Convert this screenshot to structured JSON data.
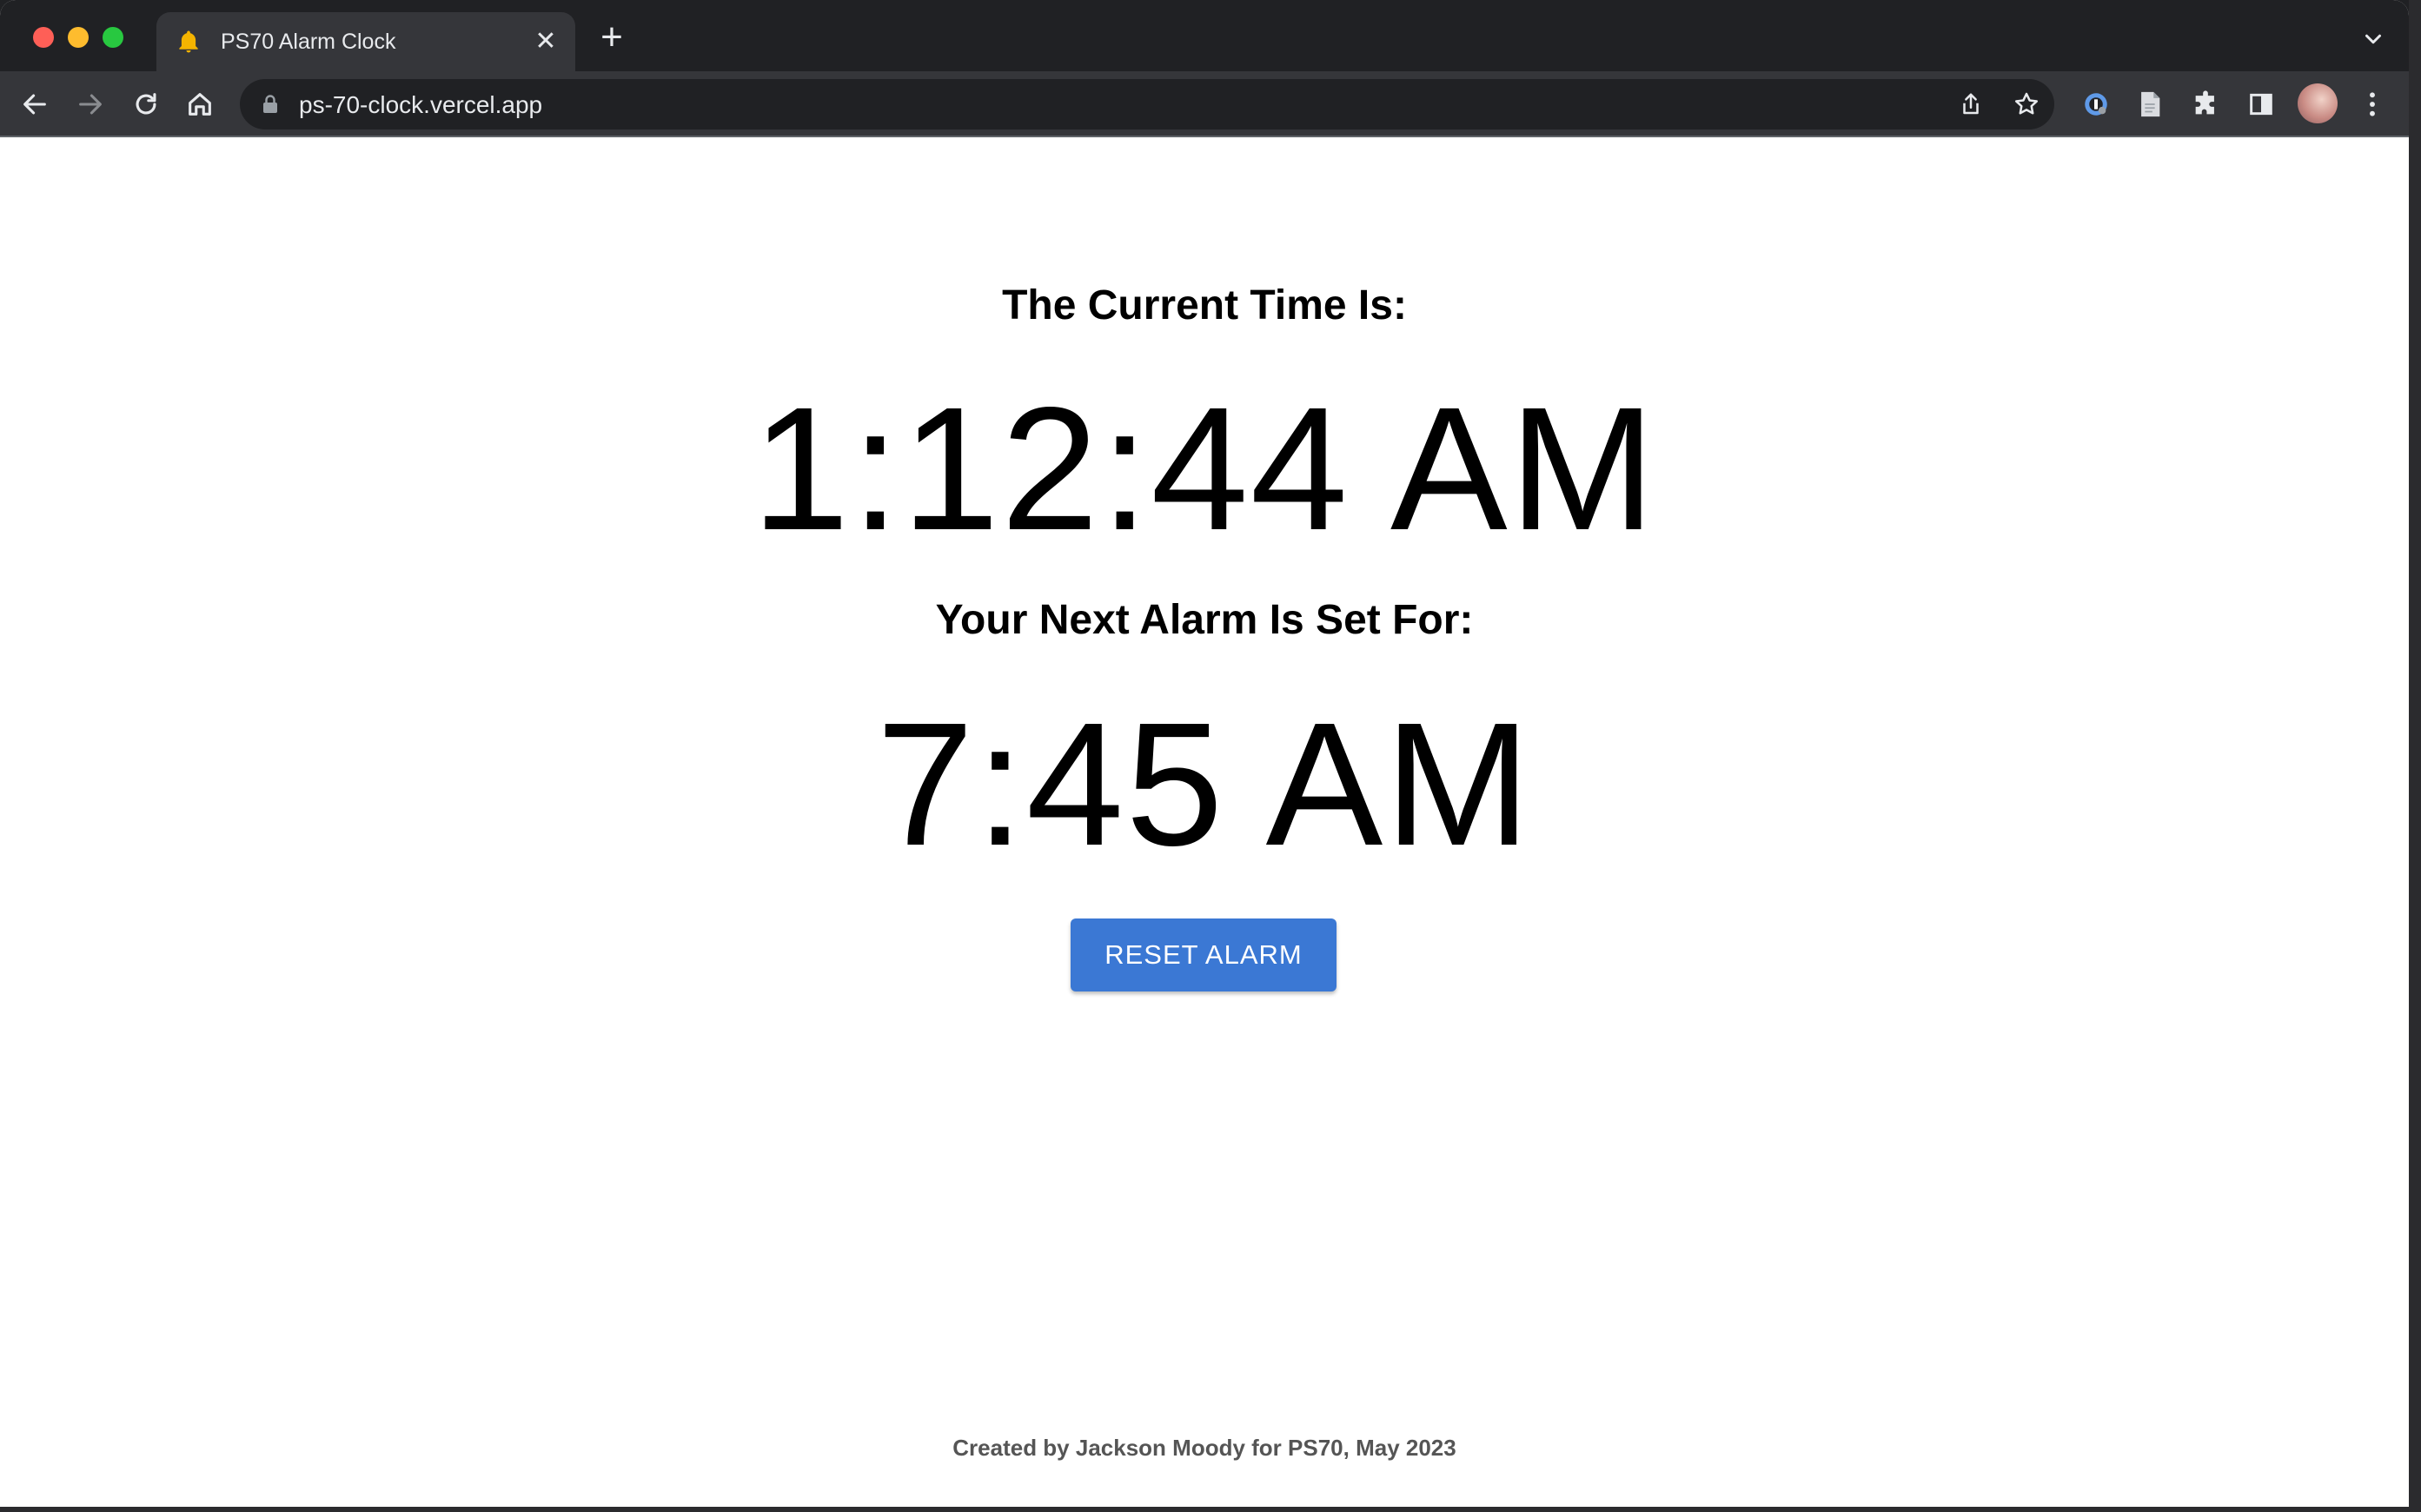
{
  "browser": {
    "tab_title": "PS70 Alarm Clock",
    "tab_close_glyph": "✕",
    "new_tab_glyph": "+",
    "url": "ps-70-clock.vercel.app"
  },
  "icons": {
    "tab_favicon": "bell-icon",
    "back": "back-arrow-icon",
    "forward": "forward-arrow-icon",
    "reload": "reload-icon",
    "home": "home-icon",
    "lock": "lock-icon",
    "share": "share-icon",
    "bookmark": "star-icon",
    "extension_1": "password-manager-icon",
    "extension_2": "document-icon",
    "extensions": "puzzle-icon",
    "side_panel": "side-panel-icon",
    "menu": "kebab-menu-icon"
  },
  "clock": {
    "current_label": "The Current Time Is:",
    "current_time": "1:12:44 AM",
    "alarm_label": "Your Next Alarm Is Set For:",
    "alarm_time": "7:45 AM",
    "reset_button": "RESET ALARM"
  },
  "footer": {
    "credit": "Created by Jackson Moody for PS70, May 2023"
  },
  "colors": {
    "button_blue": "#3b78d4",
    "tab_active": "#35363a",
    "tabstrip": "#202124"
  }
}
